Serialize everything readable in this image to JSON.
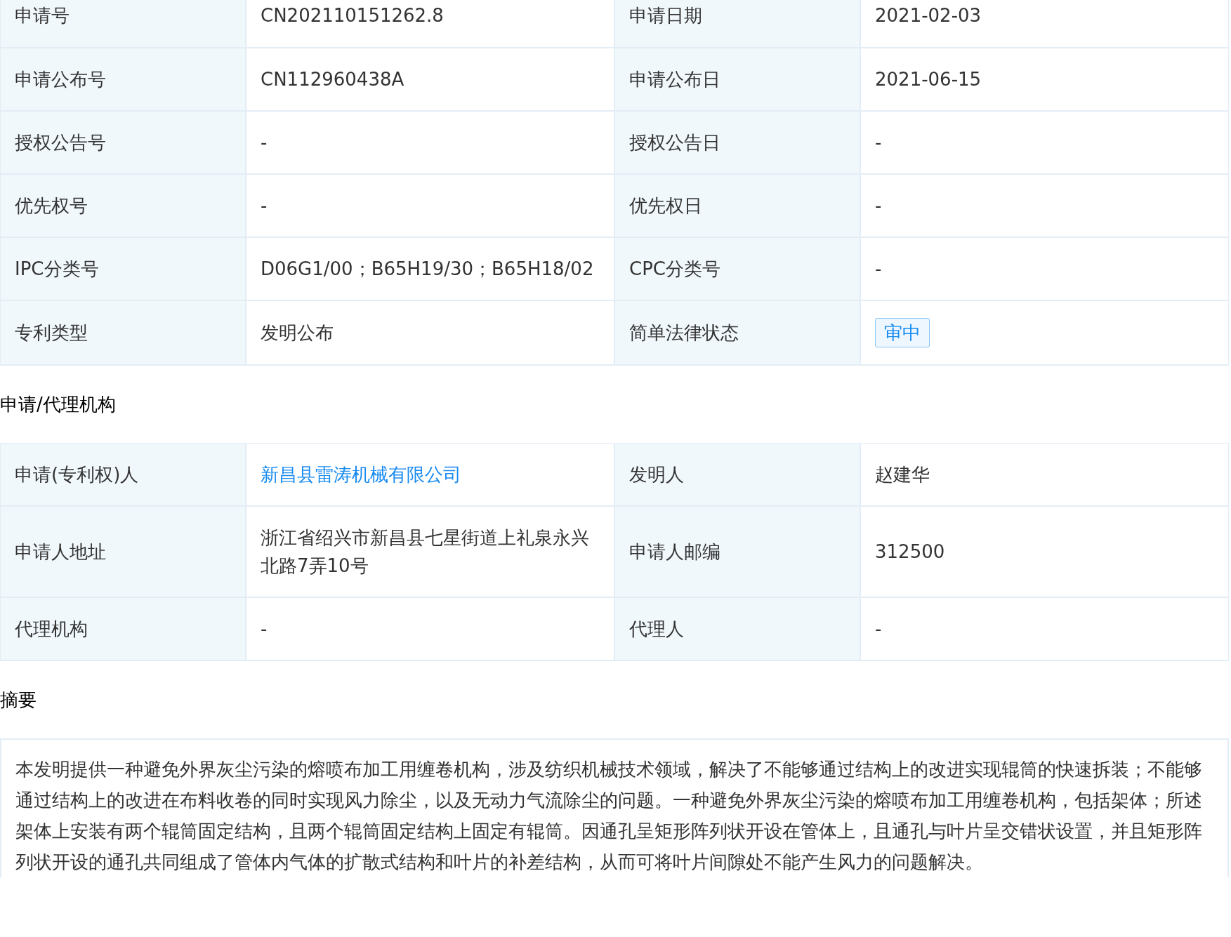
{
  "basic_info": {
    "rows": [
      [
        {
          "label": "申请号",
          "value": "CN202110151262.8",
          "kind": "text"
        },
        {
          "label": "申请日期",
          "value": "2021-02-03",
          "kind": "text"
        }
      ],
      [
        {
          "label": "申请公布号",
          "value": "CN112960438A",
          "kind": "text"
        },
        {
          "label": "申请公布日",
          "value": "2021-06-15",
          "kind": "text"
        }
      ],
      [
        {
          "label": "授权公告号",
          "value": "-",
          "kind": "text"
        },
        {
          "label": "授权公告日",
          "value": "-",
          "kind": "text"
        }
      ],
      [
        {
          "label": "优先权号",
          "value": "-",
          "kind": "text"
        },
        {
          "label": "优先权日",
          "value": "-",
          "kind": "text"
        }
      ],
      [
        {
          "label": "IPC分类号",
          "value": "D06G1/00；B65H19/30；B65H18/02",
          "kind": "text"
        },
        {
          "label": "CPC分类号",
          "value": "-",
          "kind": "text"
        }
      ],
      [
        {
          "label": "专利类型",
          "value": "发明公布",
          "kind": "text"
        },
        {
          "label": "简单法律状态",
          "value": "审中",
          "kind": "tag"
        }
      ]
    ]
  },
  "applicant_section": {
    "title": "申请/代理机构",
    "rows": [
      [
        {
          "label": "申请(专利权)人",
          "value": "新昌县雷涛机械有限公司",
          "kind": "link"
        },
        {
          "label": "发明人",
          "value": "赵建华",
          "kind": "text"
        }
      ],
      [
        {
          "label": "申请人地址",
          "value": "浙江省绍兴市新昌县七星街道上礼泉永兴北路7弄10号",
          "kind": "text"
        },
        {
          "label": "申请人邮编",
          "value": "312500",
          "kind": "text"
        }
      ],
      [
        {
          "label": "代理机构",
          "value": "-",
          "kind": "text"
        },
        {
          "label": "代理人",
          "value": "-",
          "kind": "text"
        }
      ]
    ]
  },
  "abstract_section": {
    "title": "摘要",
    "text": "本发明提供一种避免外界灰尘污染的熔喷布加工用缠卷机构，涉及纺织机械技术领域，解决了不能够通过结构上的改进实现辊筒的快速拆装；不能够通过结构上的改进在布料收卷的同时实现风力除尘，以及无动力气流除尘的问题。一种避免外界灰尘污染的熔喷布加工用缠卷机构，包括架体；所述架体上安装有两个辊筒固定结构，且两个辊筒固定结构上固定有辊筒。因通孔呈矩形阵列状开设在管体上，且通孔与叶片呈交错状设置，并且矩形阵列状开设的通孔共同组成了管体内气体的扩散式结构和叶片的补差结构，从而可将叶片间隙处不能产生风力的问题解决。"
  }
}
